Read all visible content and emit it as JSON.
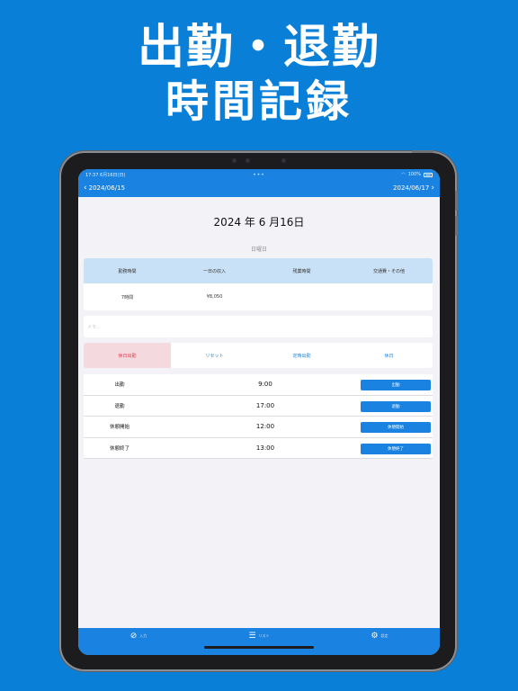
{
  "headline": {
    "line1": "出勤・退勤",
    "line2": "時間記録"
  },
  "status": {
    "time": "17:37",
    "date": "6月16日(日)",
    "dots": "•••",
    "battery_pct": "100%"
  },
  "nav": {
    "prev_date": "2024/06/15",
    "next_date": "2024/06/17"
  },
  "day": {
    "title": "2024 年 6 月16日",
    "weekday": "日曜日"
  },
  "summary": {
    "headers": [
      "勤務時間",
      "一日の収入",
      "残業時間",
      "交通費・その他"
    ],
    "values": [
      "7時間",
      "¥8,050",
      "",
      ""
    ]
  },
  "memo": {
    "placeholder": "メモ..."
  },
  "actions": [
    "休日出勤",
    "リセット",
    "定時出勤",
    "休日"
  ],
  "times": [
    {
      "label": "出勤",
      "time": "9:00",
      "button": "出勤"
    },
    {
      "label": "退勤",
      "time": "17:00",
      "button": "退勤"
    },
    {
      "label": "休憩開始",
      "time": "12:00",
      "button": "休憩開始"
    },
    {
      "label": "休憩終了",
      "time": "13:00",
      "button": "休憩終了"
    }
  ],
  "tabs": [
    {
      "icon": "edit-circle-icon",
      "label": "入力"
    },
    {
      "icon": "list-icon",
      "label": "リスト"
    },
    {
      "icon": "gear-icon",
      "label": "設定"
    }
  ],
  "colors": {
    "background": "#0a7fd8",
    "accent": "#1a82e0",
    "holiday_work": "#e03a4a"
  }
}
